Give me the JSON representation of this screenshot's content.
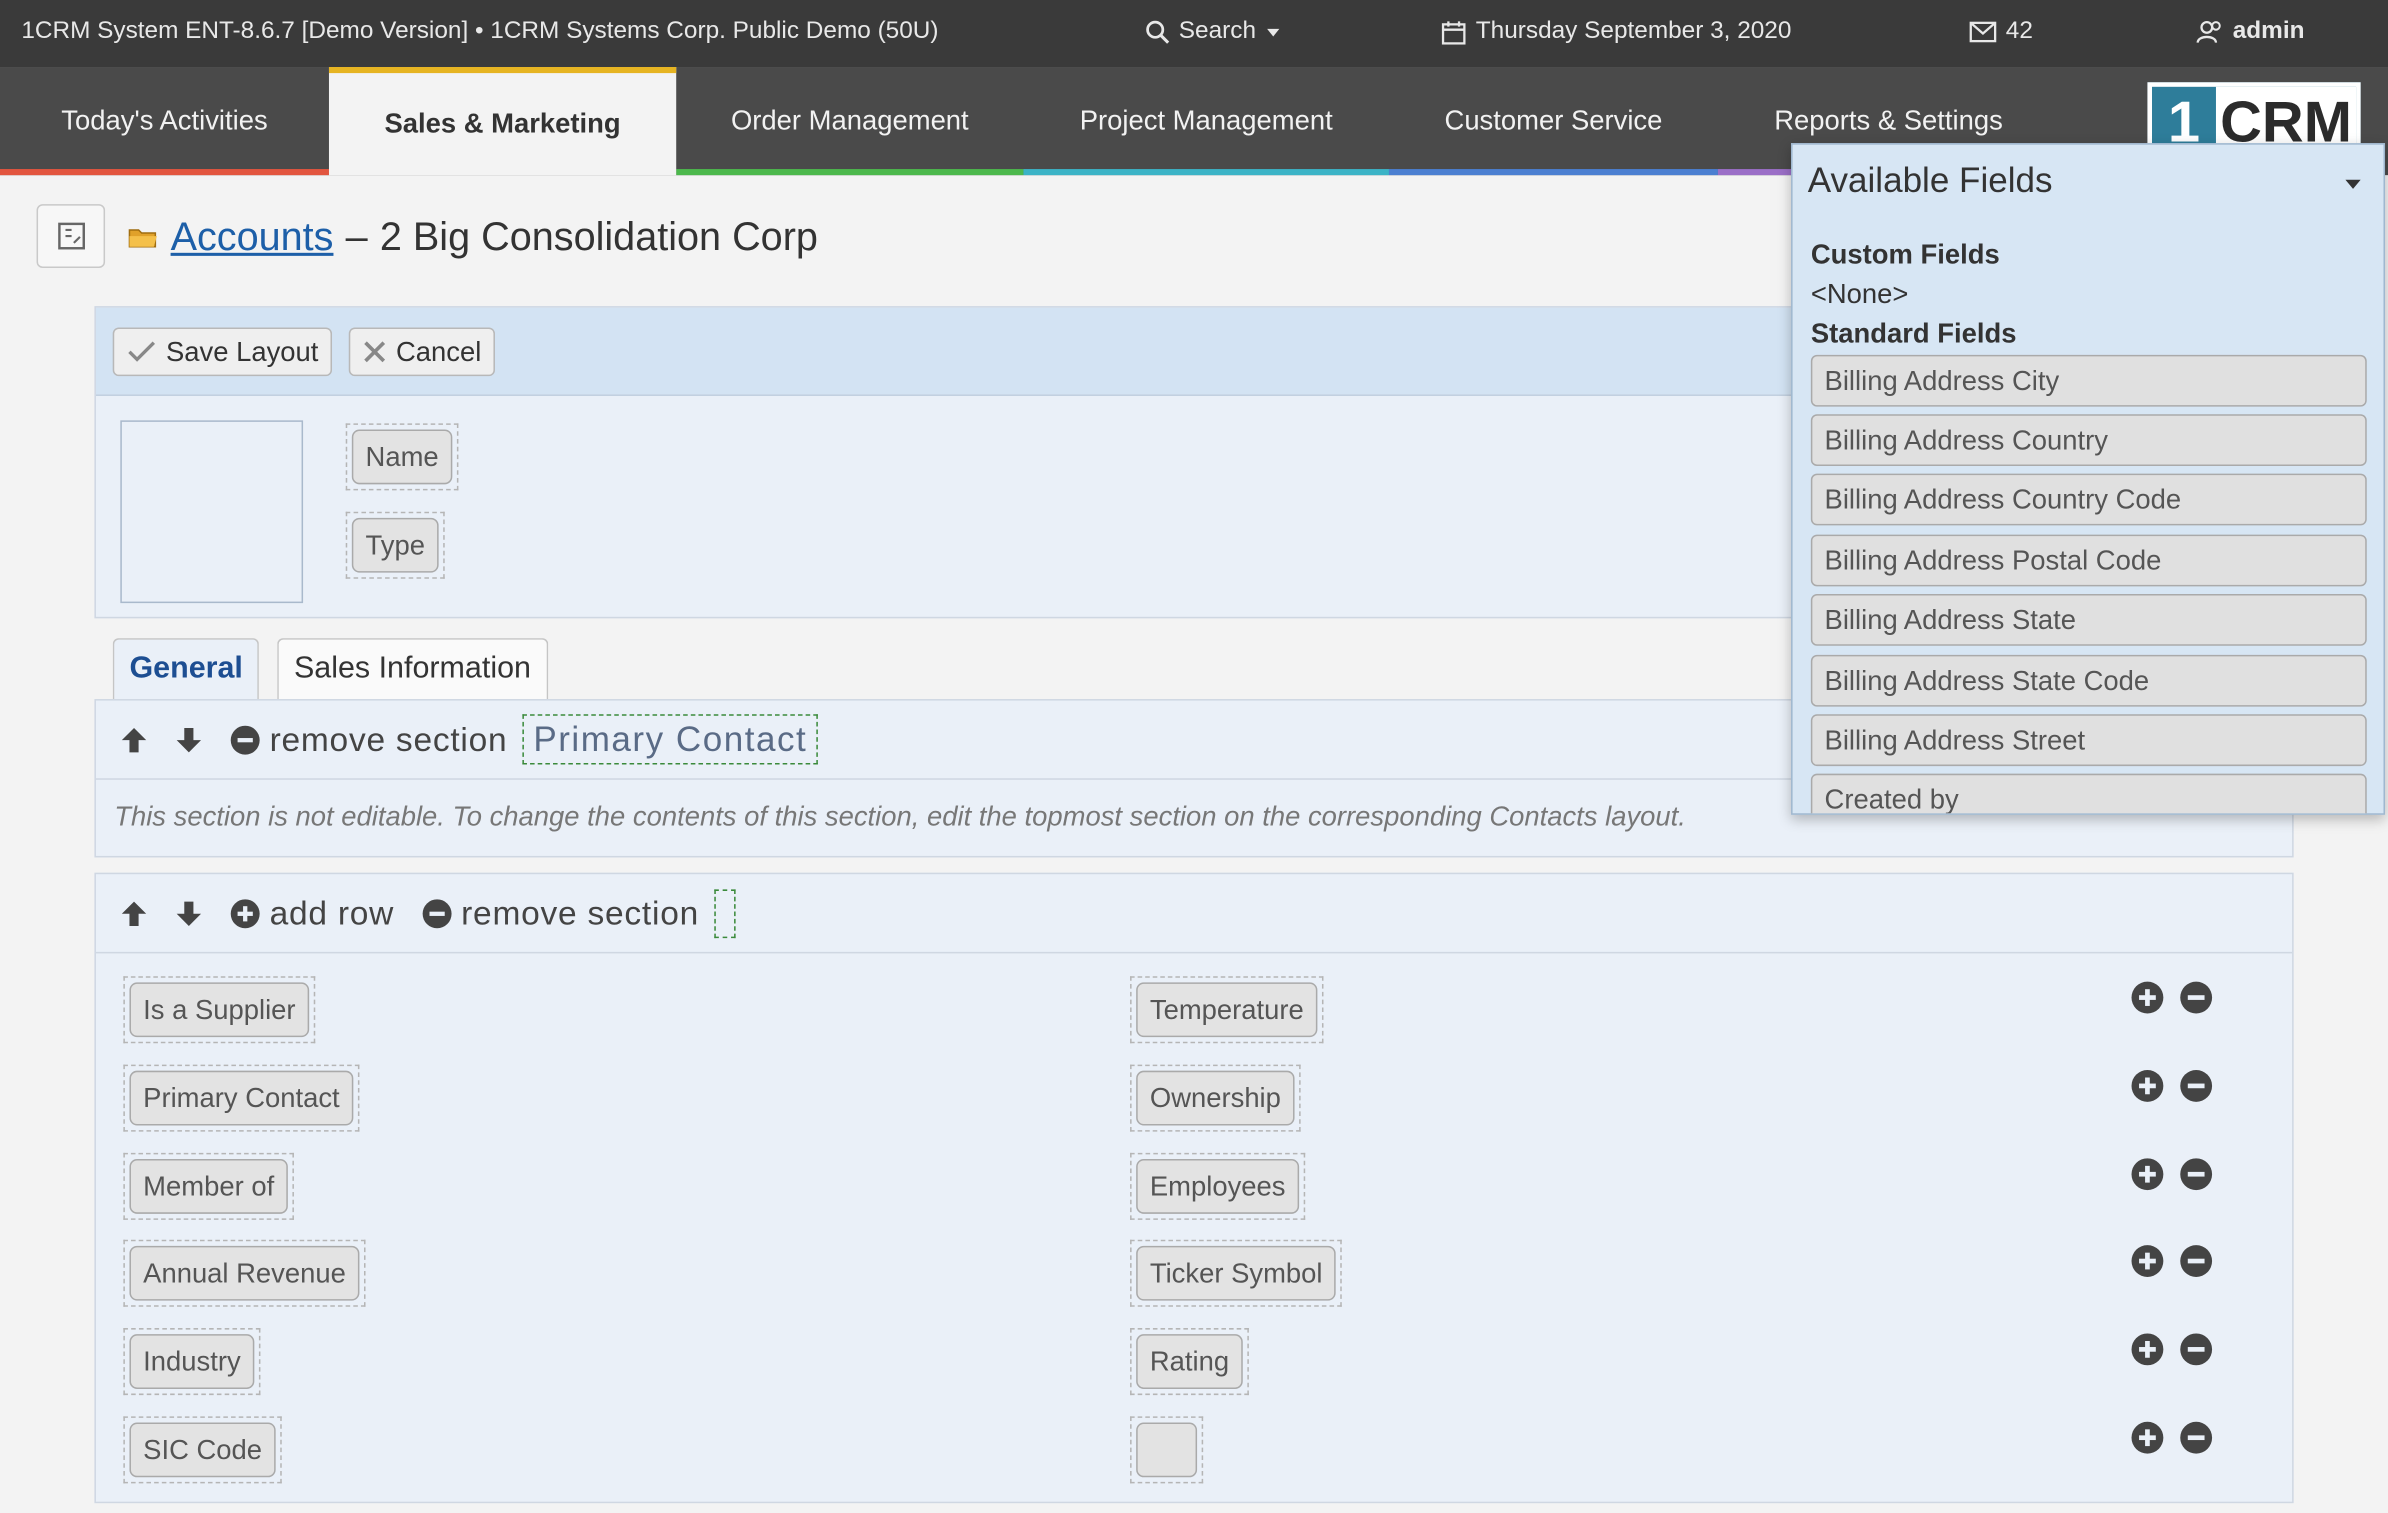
{
  "topbar": {
    "system_title": "1CRM System ENT-8.6.7 [Demo Version] • 1CRM Systems Corp. Public Demo (50U)",
    "search_label": "Search",
    "date": "Thursday September 3, 2020",
    "mail_count": "42",
    "user": "admin"
  },
  "nav": {
    "tabs": [
      {
        "label": "Today's Activities"
      },
      {
        "label": "Sales & Marketing"
      },
      {
        "label": "Order Management"
      },
      {
        "label": "Project Management"
      },
      {
        "label": "Customer Service"
      },
      {
        "label": "Reports & Settings"
      }
    ],
    "logo_one": "1",
    "logo_crm": "CRM"
  },
  "header": {
    "module_link": "Accounts",
    "separator": "–",
    "record_name": "2 Big Consolidation Corp"
  },
  "toolbar": {
    "save_label": "Save Layout",
    "cancel_label": "Cancel"
  },
  "top_fields": [
    "Name",
    "Type"
  ],
  "tabs": [
    "General",
    "Sales Information"
  ],
  "section1": {
    "remove_label": "remove section",
    "name": "Primary Contact",
    "note": "This section is not editable. To change the contents of this section, edit the topmost section on the corresponding Contacts layout."
  },
  "section2": {
    "add_row_label": "add row",
    "remove_label": "remove section",
    "left_fields": [
      "Is a Supplier",
      "Primary Contact",
      "Member of",
      "Annual Revenue",
      "Industry",
      "SIC Code"
    ],
    "right_fields": [
      "Temperature",
      "Ownership",
      "Employees",
      "Ticker Symbol",
      "Rating",
      ""
    ]
  },
  "available": {
    "title": "Available Fields",
    "custom_label": "Custom Fields",
    "custom_none": "<None>",
    "standard_label": "Standard Fields",
    "fields": [
      "Billing Address City",
      "Billing Address Country",
      "Billing Address Country Code",
      "Billing Address Postal Code",
      "Billing Address State",
      "Billing Address State Code",
      "Billing Address Street",
      "Created by"
    ]
  },
  "colors": {
    "nav_bar_red": "#e2553f",
    "nav_bar_green": "#4cb84c",
    "nav_bar_teal": "#3bb3c6",
    "nav_bar_blue": "#4b7fd1",
    "nav_bar_purple": "#9b6fc7",
    "link_blue": "#1d5fa8"
  }
}
